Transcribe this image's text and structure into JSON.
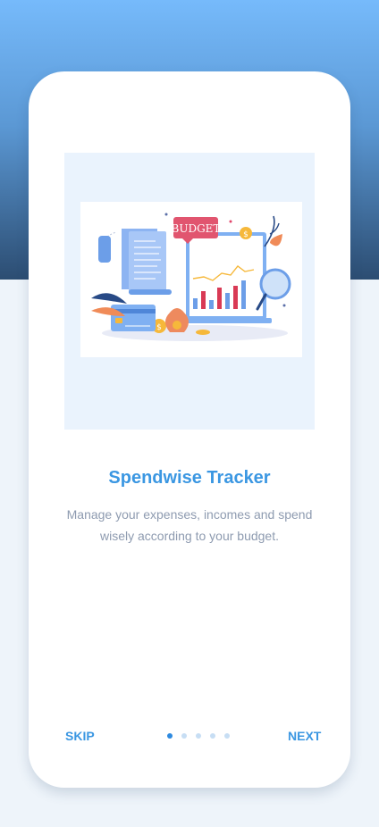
{
  "onboarding": {
    "title": "Spendwise Tracker",
    "description": "Manage your expenses, incomes and spend wisely according to your budget.",
    "skip_label": "SKIP",
    "next_label": "NEXT",
    "page_count": 5,
    "current_page": 1,
    "illustration": {
      "sign_text": "BUDGET",
      "coin_symbol": "$"
    }
  },
  "colors": {
    "accent": "#3b97e2",
    "dot_active": "#2e8ae0",
    "dot_inactive": "#c7def4",
    "description_text": "#8e9bb0",
    "header_gradient_top": "#76bafb",
    "header_gradient_bottom": "#2c4d72"
  }
}
